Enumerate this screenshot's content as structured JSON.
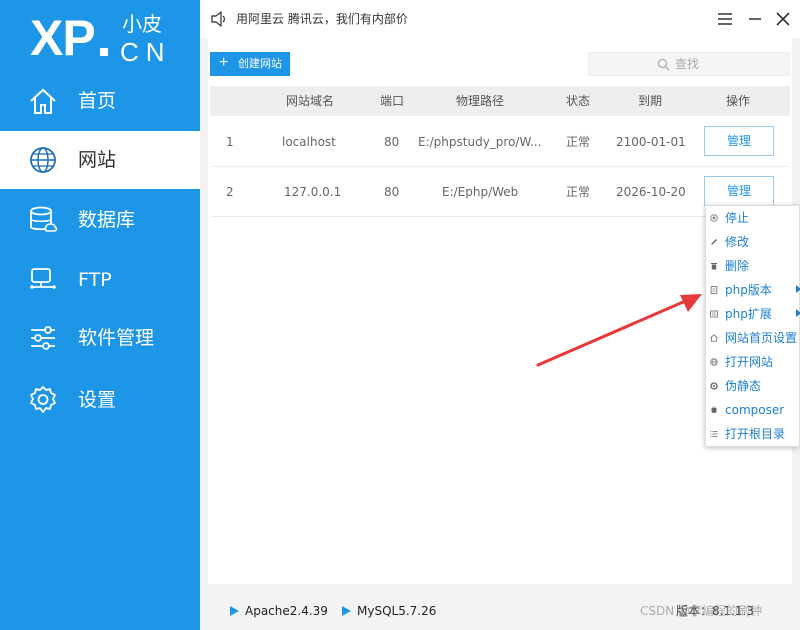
{
  "sidebar": {
    "logo": {
      "main": "XP",
      "small_top": "小皮",
      "small_bottom": "CN"
    },
    "items": [
      {
        "label": "首页",
        "icon": "home-icon"
      },
      {
        "label": "网站",
        "icon": "globe-icon",
        "active": true
      },
      {
        "label": "数据库",
        "icon": "database-icon"
      },
      {
        "label": "FTP",
        "icon": "monitor-icon"
      },
      {
        "label": "软件管理",
        "icon": "sliders-icon"
      },
      {
        "label": "设置",
        "icon": "gear-icon"
      }
    ]
  },
  "titlebar": {
    "notice": "用阿里云 腾讯云，我们有内部价",
    "icons": [
      "speaker-icon",
      "menu-icon",
      "minimize-icon",
      "close-icon"
    ]
  },
  "toolbar": {
    "create_label": "创建网站",
    "search_placeholder": "查找"
  },
  "table": {
    "headers": [
      "网站域名",
      "端口",
      "物理路径",
      "状态",
      "到期",
      "操作"
    ],
    "rows": [
      {
        "index": "1",
        "domain": "localhost",
        "port": "80",
        "path": "E:/phpstudy_pro/W...",
        "status": "正常",
        "expire": "2100-01-01",
        "action": "管理"
      },
      {
        "index": "2",
        "domain": "127.0.0.1",
        "port": "80",
        "path": "E:/Ephp/Web",
        "status": "正常",
        "expire": "2026-10-20",
        "action": "管理"
      }
    ]
  },
  "context_menu": {
    "items": [
      {
        "label": "停止",
        "icon": "stop-icon"
      },
      {
        "label": "修改",
        "icon": "pencil-icon"
      },
      {
        "label": "删除",
        "icon": "trash-icon"
      },
      {
        "label": "php版本",
        "icon": "file-icon",
        "submenu": true
      },
      {
        "label": "php扩展",
        "icon": "extension-icon",
        "submenu": true
      },
      {
        "label": "网站首页设置",
        "icon": "home-icon"
      },
      {
        "label": "打开网站",
        "icon": "globe-icon"
      },
      {
        "label": "伪静态",
        "icon": "refresh-icon"
      },
      {
        "label": "composer",
        "icon": "composer-icon"
      },
      {
        "label": "打开根目录",
        "icon": "list-icon"
      }
    ]
  },
  "statusbar": {
    "apache": "Apache2.4.39",
    "mysql": "MySQL5.7.26",
    "version": "版本：8.1.1.3",
    "watermark": "CSDN @李编程的刷钟"
  },
  "colors": {
    "accent": "#1e96e8",
    "arrow": "#e8393a"
  }
}
